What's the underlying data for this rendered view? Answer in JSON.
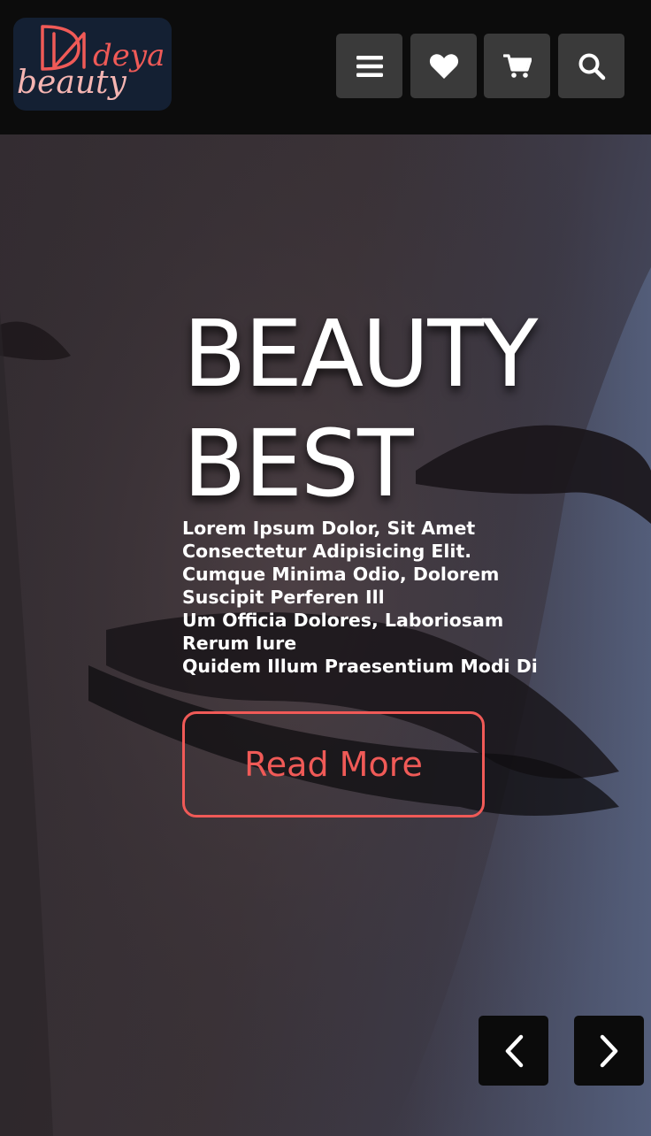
{
  "logo": {
    "word_top": "deya",
    "word_bottom": "beauty",
    "colors": {
      "background": "#142033",
      "accent": "#f05a57",
      "light": "#f5b5b2"
    }
  },
  "header": {
    "buttons": [
      {
        "name": "menu",
        "icon": "bars-icon"
      },
      {
        "name": "wishlist",
        "icon": "heart-icon"
      },
      {
        "name": "cart",
        "icon": "cart-icon"
      },
      {
        "name": "search",
        "icon": "search-icon"
      }
    ],
    "button_color": "#3a3a3a"
  },
  "hero": {
    "title_line1": "BEAUTY",
    "title_line2": "BEST",
    "description_lines": [
      "Lorem Ipsum Dolor, Sit Amet",
      "Consectetur Adipisicing Elit.",
      "Cumque Minima Odio, Dolorem",
      "Suscipit Perferen Ill",
      "Um Officia Dolores, Laboriosam",
      "Rerum Iure",
      "Quidem Illum Praesentium Modi Di"
    ],
    "cta_label": "Read More",
    "accent_color": "#f05a57"
  },
  "slider": {
    "prev_icon": "chevron-left-icon",
    "next_icon": "chevron-right-icon"
  }
}
